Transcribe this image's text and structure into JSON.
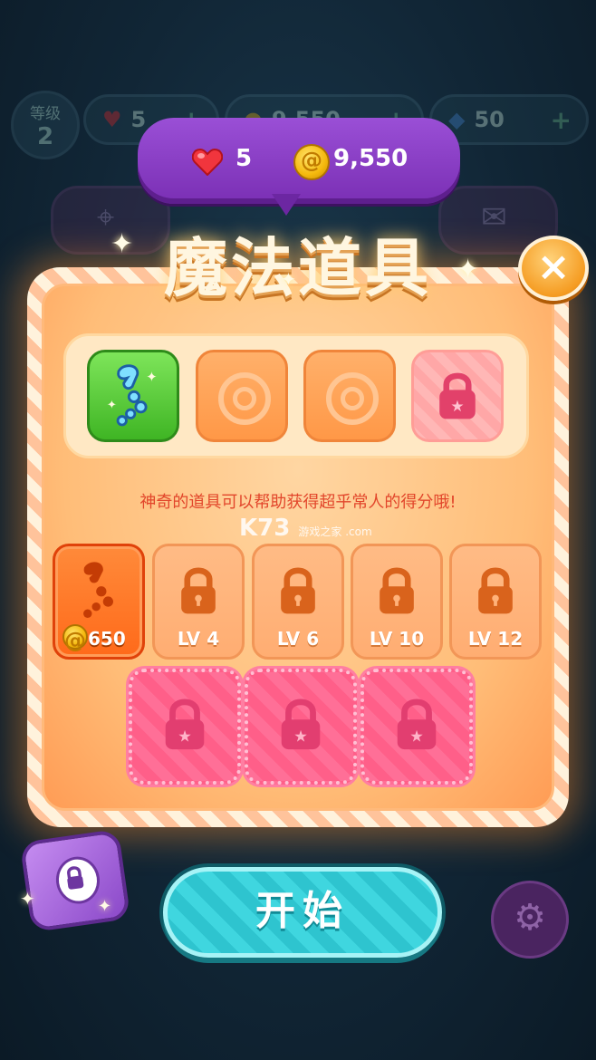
{
  "hud_bg": {
    "level_label": "等级",
    "level_value": "2",
    "lives": "5",
    "coins_partial": "9,550",
    "gems": "50",
    "plus": "+"
  },
  "bubble": {
    "lives": "5",
    "coins": "9,550"
  },
  "dialog": {
    "title": "魔法道具",
    "close_symbol": "×",
    "description": "神奇的道具可以帮助获得超乎常人的得分哦!",
    "watermark_main": "K73",
    "watermark_sub": "游戏之家 .com"
  },
  "items": [
    {
      "state": "active",
      "price": "650"
    },
    {
      "state": "locked",
      "label": "LV 4"
    },
    {
      "state": "locked",
      "label": "LV 6"
    },
    {
      "state": "locked",
      "label": "LV 10"
    },
    {
      "state": "locked",
      "label": "LV 12"
    }
  ],
  "start_button": "开始",
  "colors": {
    "accent_purple": "#8a3fc6",
    "panel_orange": "#ffbd78",
    "start_teal": "#2ec4cf",
    "description_red": "#e2462b"
  },
  "icons": [
    "heart-icon",
    "coin-icon",
    "gem-icon",
    "map-pin-icon",
    "mail-icon",
    "lock-icon",
    "swirl-icon",
    "footprint-icon",
    "gear-icon",
    "chest-icon",
    "close-icon"
  ]
}
